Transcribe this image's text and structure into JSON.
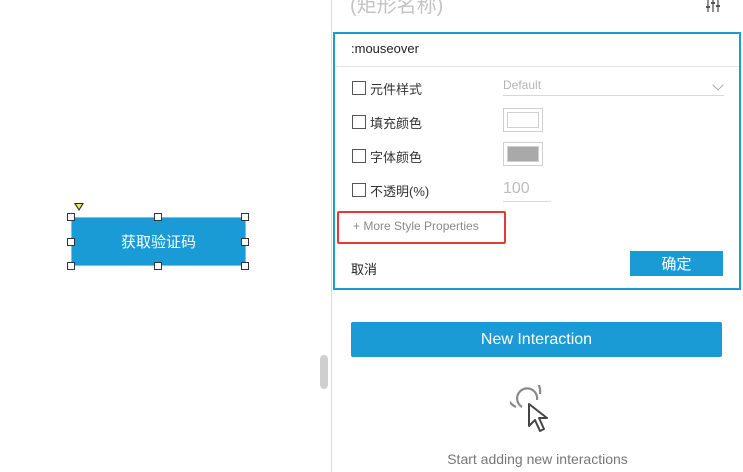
{
  "canvas": {
    "widget_label": "获取验证码"
  },
  "panel": {
    "title": "(矩形名称)",
    "style_editor": {
      "event_name": ":mouseover",
      "rows": [
        {
          "label": "元件样式",
          "checked": false
        },
        {
          "label": "填充颜色",
          "checked": false
        },
        {
          "label": "字体颜色",
          "checked": false
        },
        {
          "label": "不透明(%)",
          "checked": false
        }
      ],
      "style_select": {
        "value": "Default"
      },
      "fill_color": "#ffffff",
      "font_color": "#a9a9a9",
      "opacity_value": "100",
      "more_style_label": "+ More Style Properties",
      "cancel_label": "取消",
      "confirm_label": "确定"
    },
    "new_interaction_label": "New Interaction",
    "empty_hint": "Start adding new interactions"
  },
  "colors": {
    "accent": "#1a9bd6",
    "highlight_red": "#e53935"
  },
  "icons": [
    "settings-sliders-icon",
    "pointer-click-icon",
    "interaction-marker-icon",
    "chevron-down-icon"
  ]
}
